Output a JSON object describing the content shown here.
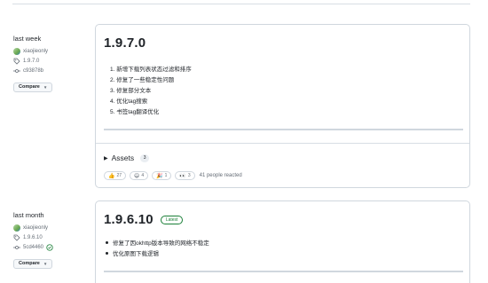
{
  "releases": [
    {
      "when": "last week",
      "author": "xiaojieonly",
      "tag": "1.9.7.0",
      "commit": "c93878b",
      "compare_label": "Compare",
      "title": "1.9.7.0",
      "notes": [
        "1. 新增下载列表状态过滤和排序",
        "2. 修复了一些稳定性问题",
        "3. 修复部分文本",
        "4. 优化tag搜索",
        "5. 书签tag翻译优化"
      ],
      "assets_label": "Assets",
      "assets_count": "3",
      "reactions": [
        {
          "icon": "thumbs-up-icon",
          "glyph": "👍",
          "count": "27"
        },
        {
          "icon": "laugh-icon",
          "glyph": "😄",
          "count": "4"
        },
        {
          "icon": "tada-icon",
          "glyph": "🎉",
          "count": "1"
        },
        {
          "icon": "eyes-icon",
          "glyph": "👀",
          "count": "3"
        }
      ],
      "reacted_text": "41 people reacted"
    },
    {
      "when": "last month",
      "author": "xiaojieonly",
      "tag": "1.9.6.10",
      "commit": "5cd4460",
      "compare_label": "Compare",
      "title": "1.9.6.10",
      "latest_label": "Latest",
      "notes": [
        "修复了因okhttp版本导致的网络不稳定",
        "优化原图下载逻辑"
      ]
    }
  ]
}
